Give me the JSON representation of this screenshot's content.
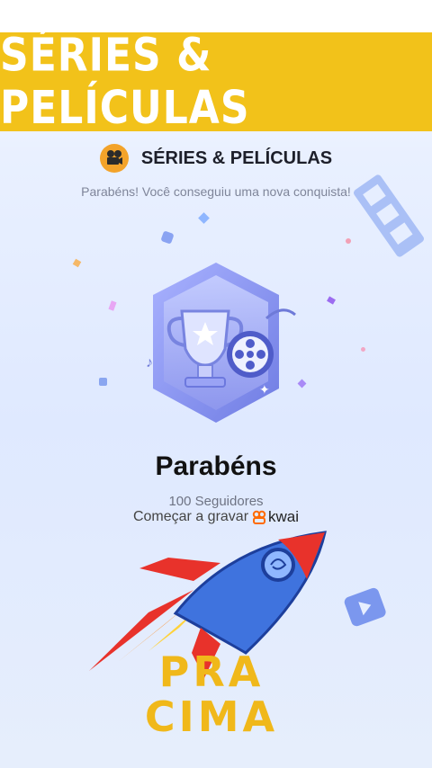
{
  "banner": {
    "title": "SÉRIES & PELÍCULAS"
  },
  "header": {
    "title": "SÉRIES & PELÍCULAS",
    "icon": "film-camera-icon"
  },
  "subtitle": "Parabéns! Você conseguiu uma nova conquista!",
  "achievement": {
    "title": "Parabéns",
    "followers": "100 Seguidores",
    "record_label": "Começar a gravar",
    "brand": "kwai"
  },
  "overlay": {
    "line1": "PRA",
    "line2": "CIMA"
  },
  "colors": {
    "banner": "#f2c21a",
    "badge": "#8d95f0",
    "overlay_text": "#f0b81a",
    "rocket_body": "#3f73de"
  }
}
